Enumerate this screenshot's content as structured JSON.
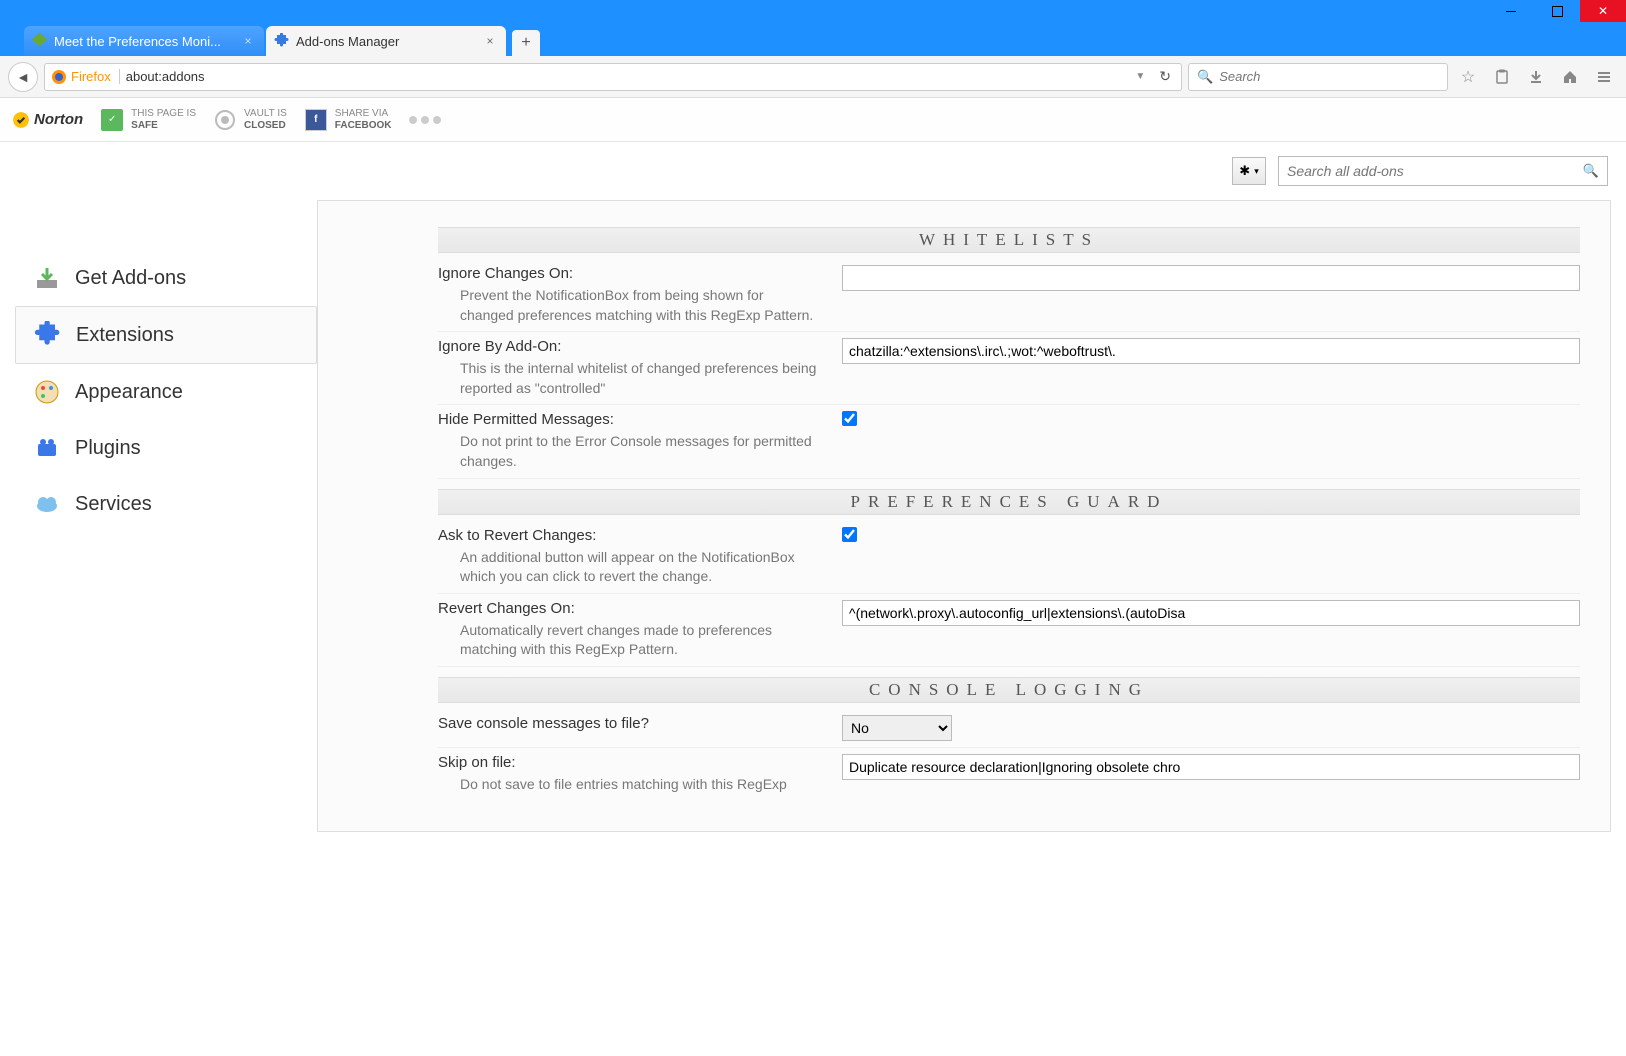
{
  "tabs": [
    {
      "label": "Meet the Preferences Moni..."
    },
    {
      "label": "Add-ons Manager"
    }
  ],
  "urlbar": {
    "brand": "Firefox",
    "url": "about:addons"
  },
  "searchbar": {
    "placeholder": "Search"
  },
  "norton": {
    "logo": "Norton",
    "page_safe_line1": "THIS PAGE IS",
    "page_safe_line2": "SAFE",
    "vault_line1": "VAULT IS",
    "vault_line2": "CLOSED",
    "share_line1": "SHARE VIA",
    "share_line2": "FACEBOOK"
  },
  "addon_top": {
    "search_placeholder": "Search all add-ons"
  },
  "sidebar": [
    {
      "id": "get",
      "label": "Get Add-ons"
    },
    {
      "id": "ext",
      "label": "Extensions"
    },
    {
      "id": "app",
      "label": "Appearance"
    },
    {
      "id": "plg",
      "label": "Plugins"
    },
    {
      "id": "svc",
      "label": "Services"
    }
  ],
  "sections": {
    "whitelists": {
      "title": "WHITELISTS",
      "ignore_changes": {
        "label": "Ignore Changes On:",
        "desc": "Prevent the NotificationBox from being shown for changed preferences matching with this RegExp Pattern.",
        "value": ""
      },
      "ignore_addon": {
        "label": "Ignore By Add-On:",
        "desc": "This is the internal whitelist of changed preferences being reported as \"controlled\"",
        "value": "chatzilla:^extensions\\.irc\\.;wot:^weboftrust\\."
      },
      "hide_permitted": {
        "label": "Hide Permitted Messages:",
        "desc": "Do not print to the Error Console messages for permitted changes.",
        "checked": true
      }
    },
    "guard": {
      "title": "PREFERENCES GUARD",
      "ask_revert": {
        "label": "Ask to Revert Changes:",
        "desc": "An additional button will appear on the NotificationBox which you can click to revert the change.",
        "checked": true
      },
      "revert_on": {
        "label": "Revert Changes On:",
        "desc": "Automatically revert changes made to preferences matching with this RegExp Pattern.",
        "value": "^(network\\.proxy\\.autoconfig_url|extensions\\.(autoDisa"
      }
    },
    "console": {
      "title": "CONSOLE LOGGING",
      "save_file": {
        "label": "Save console messages to file?",
        "value": "No"
      },
      "skip_file": {
        "label": "Skip on file:",
        "desc": "Do not save to file entries matching with this RegExp",
        "value": "Duplicate resource declaration|Ignoring obsolete chro"
      }
    }
  }
}
